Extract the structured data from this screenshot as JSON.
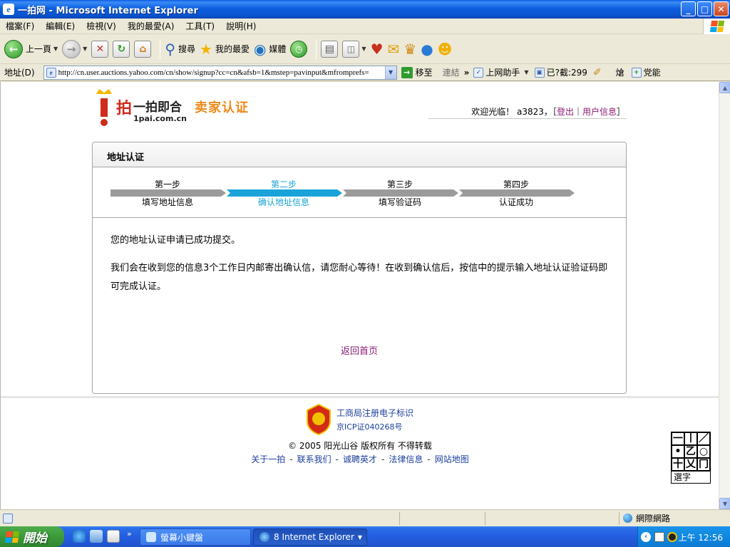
{
  "window": {
    "title": "一拍网 - Microsoft Internet Explorer",
    "app_icon": "e"
  },
  "window_buttons": {
    "minimize": "_",
    "maximize": "□",
    "close": "✕"
  },
  "menu": {
    "items": [
      "檔案(F)",
      "編輯(E)",
      "檢視(V)",
      "我的最愛(A)",
      "工具(T)",
      "說明(H)"
    ]
  },
  "toolbar": {
    "back_label": "上一頁",
    "search_label": "搜尋",
    "favorites_label": "我的最愛",
    "media_label": "媒體"
  },
  "address": {
    "label": "地址(D)",
    "url": "http://cn.user.auctions.yahoo.com/cn/show/signup?cc=cn&afsb=1&mstep=pavinput&mfromprefs=",
    "go_label": "移至",
    "links_label": "連結",
    "chevron": "»",
    "assistant_label": "上网助手",
    "blocked_label": "已?截:299",
    "extra1": "熗",
    "extra2": "党能"
  },
  "site": {
    "brand_glyph": "拍",
    "brand_text": "一拍即合",
    "domain": "1pai.com.cn",
    "section_title": "卖家认证",
    "welcome_prefix": "欢迎光临！ a3823，［",
    "logout_label": "登出",
    "welcome_sep": "｜",
    "userinfo_label": "用户信息",
    "welcome_suffix": "］"
  },
  "box": {
    "title": "地址认证",
    "steps": [
      {
        "no": "第一步",
        "name": "填写地址信息",
        "active": false
      },
      {
        "no": "第二步",
        "name": "确认地址信息",
        "active": true
      },
      {
        "no": "第三步",
        "name": "填写验证码",
        "active": false
      },
      {
        "no": "第四步",
        "name": "认证成功",
        "active": false
      }
    ],
    "message1": "您的地址认证申请已成功提交。",
    "message2": "我们会在收到您的信息3个工作日内邮寄出确认信，请您耐心等待！在收到确认信后，按信中的提示输入地址认证验证码即可完成认证。",
    "back_home": "返回首页"
  },
  "footer": {
    "badge_glyph": "工商",
    "badge_line1": "工商局注册电子标识",
    "badge_line2": "京ICP证040268号",
    "copyright": "© 2005  阳光山谷  版权所有  不得转载",
    "links": [
      "关于一拍",
      "联系我们",
      "诚聘英才",
      "法律信息",
      "网站地图"
    ],
    "link_sep": "-"
  },
  "ime_pad": {
    "bottom_label": "選字",
    "cells": [
      "一",
      "丨",
      "／",
      "•",
      "乙",
      "○",
      "十",
      "乂",
      "冂"
    ]
  },
  "status": {
    "zone": "網際網路"
  },
  "taskbar": {
    "start_label": "開始",
    "task1_label": "螢幕小鍵盤",
    "task2_label": "8 Internet Explorer",
    "clock": "上午 12:56",
    "expand": "»"
  },
  "colors": {
    "titlebar": "#0a5de2",
    "accent_blue": "#1aa3d8",
    "step_grey": "#9b9b9b",
    "link_purple": "#8a1a73",
    "footer_link": "#1c3f9c",
    "brand_red": "#d02b1b",
    "section_orange": "#ef8a1a"
  }
}
